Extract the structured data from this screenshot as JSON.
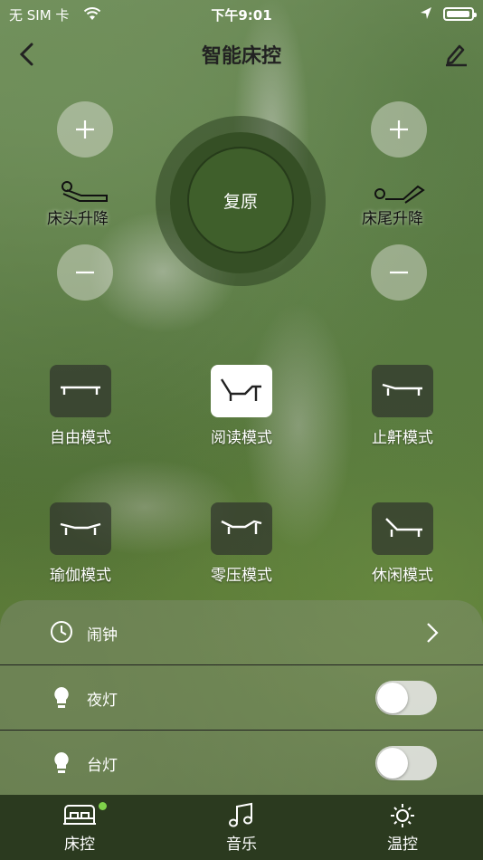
{
  "status_bar": {
    "carrier": "无 SIM 卡",
    "time": "下午9:01"
  },
  "nav": {
    "title": "智能床控"
  },
  "head_control": {
    "label": "床头升降"
  },
  "foot_control": {
    "label": "床尾升降"
  },
  "center": {
    "label": "复原"
  },
  "modes": [
    {
      "label": "自由模式",
      "active": false
    },
    {
      "label": "阅读模式",
      "active": true
    },
    {
      "label": "止鼾模式",
      "active": false
    },
    {
      "label": "瑜伽模式",
      "active": false
    },
    {
      "label": "零压模式",
      "active": false
    },
    {
      "label": "休闲模式",
      "active": false
    }
  ],
  "settings": [
    {
      "label": "闹钟",
      "icon": "clock-icon",
      "control": "chevron"
    },
    {
      "label": "夜灯",
      "icon": "bulb-icon",
      "control": "toggle",
      "on": false
    },
    {
      "label": "台灯",
      "icon": "bulb-icon",
      "control": "toggle",
      "on": false
    }
  ],
  "tabs": [
    {
      "label": "床控",
      "icon": "bed-icon",
      "badge": true
    },
    {
      "label": "音乐",
      "icon": "music-icon",
      "badge": false
    },
    {
      "label": "温控",
      "icon": "sun-icon",
      "badge": false
    }
  ],
  "colors": {
    "primary_green": "#3f5f2b",
    "tabbar": "#2b3a1f",
    "badge": "#7fd14a"
  }
}
